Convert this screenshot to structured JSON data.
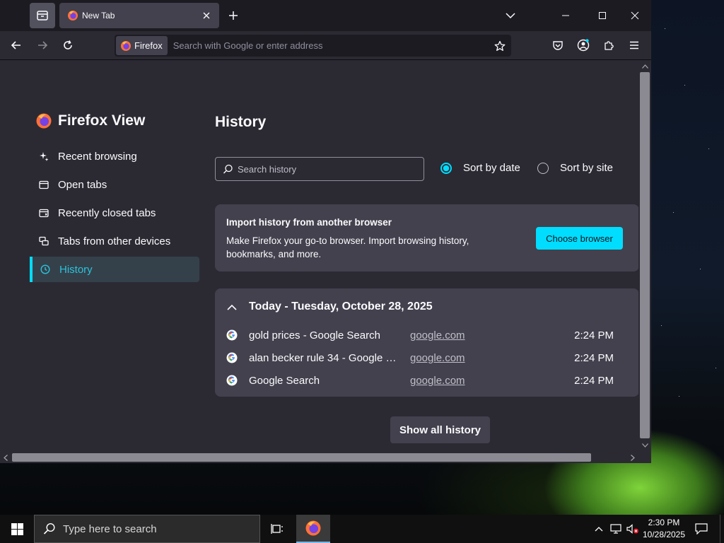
{
  "browser": {
    "tab": {
      "title": "New Tab"
    },
    "urlbar": {
      "identity_label": "Firefox",
      "placeholder": "Search with Google or enter address"
    }
  },
  "firefox_view": {
    "sidebar": {
      "heading": "Firefox View",
      "items": [
        {
          "label": "Recent browsing",
          "icon": "sparkle-icon",
          "active": false
        },
        {
          "label": "Open tabs",
          "icon": "folder-icon",
          "active": false
        },
        {
          "label": "Recently closed tabs",
          "icon": "closed-tab-icon",
          "active": false
        },
        {
          "label": "Tabs from other devices",
          "icon": "synced-tabs-icon",
          "active": false
        },
        {
          "label": "History",
          "icon": "clock-icon",
          "active": true
        }
      ]
    },
    "history": {
      "title": "History",
      "search_placeholder": "Search history",
      "sort_options": [
        {
          "label": "Sort by date",
          "checked": true
        },
        {
          "label": "Sort by site",
          "checked": false
        }
      ],
      "import_card": {
        "title": "Import history from another browser",
        "description": "Make Firefox your go-to browser. Import browsing history, bookmarks, and more.",
        "button": "Choose browser"
      },
      "date_group": "Today - Tuesday, October 28, 2025",
      "entries": [
        {
          "title": "gold prices - Google Search",
          "domain": "google.com",
          "time": "2:24 PM"
        },
        {
          "title": "alan becker rule 34 - Google S...",
          "domain": "google.com",
          "time": "2:24 PM"
        },
        {
          "title": "Google Search",
          "domain": "google.com",
          "time": "2:24 PM"
        }
      ],
      "show_all": "Show all history"
    }
  },
  "taskbar": {
    "search_placeholder": "Type here to search",
    "time": "2:30 PM",
    "date": "10/28/2025"
  },
  "colors": {
    "accent": "#00ddff",
    "background": "#2b2a33",
    "card": "#42414d"
  }
}
